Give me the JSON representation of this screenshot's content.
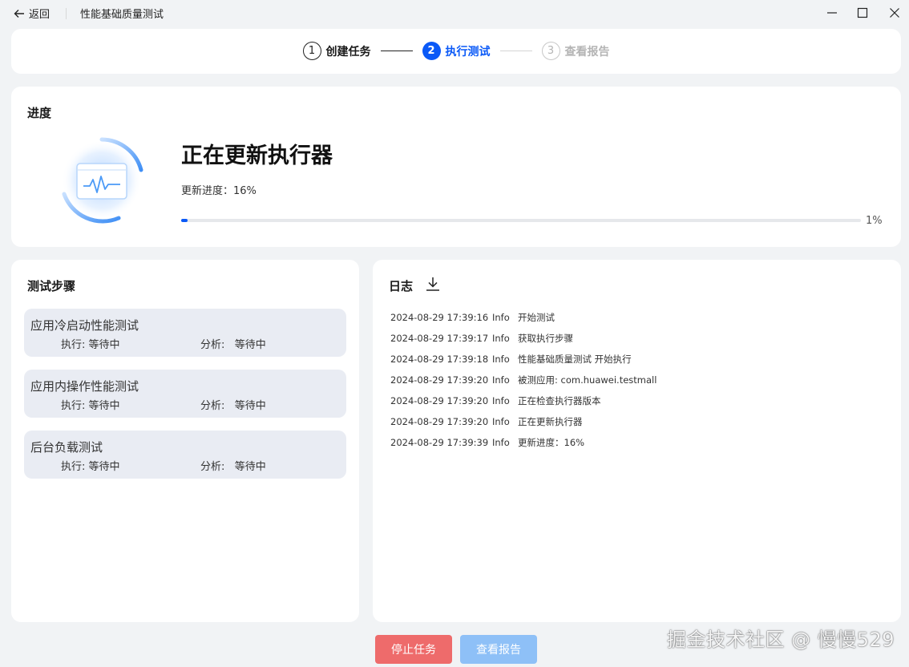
{
  "titlebar": {
    "back_label": "返回",
    "title": "性能基础质量测试"
  },
  "stepper": {
    "steps": [
      {
        "num": "1",
        "label": "创建任务",
        "state": "done"
      },
      {
        "num": "2",
        "label": "执行测试",
        "state": "active"
      },
      {
        "num": "3",
        "label": "查看报告",
        "state": "pending"
      }
    ]
  },
  "progress": {
    "section_title": "进度",
    "status_title": "正在更新执行器",
    "sub_text": "更新进度：16%",
    "bar_value": 0.01,
    "bar_percent_text": "1%"
  },
  "test_steps": {
    "section_title": "测试步骤",
    "items": [
      {
        "name": "应用冷启动性能测试",
        "exec_label": "执行:",
        "exec_value": "等待中",
        "analysis_label": "分析:",
        "analysis_value": "等待中"
      },
      {
        "name": "应用内操作性能测试",
        "exec_label": "执行:",
        "exec_value": "等待中",
        "analysis_label": "分析:",
        "analysis_value": "等待中"
      },
      {
        "name": "后台负载测试",
        "exec_label": "执行:",
        "exec_value": "等待中",
        "analysis_label": "分析:",
        "analysis_value": "等待中"
      }
    ]
  },
  "log": {
    "section_title": "日志",
    "entries": [
      {
        "time": "2024-08-29 17:39:16",
        "level": "Info",
        "message": "开始测试"
      },
      {
        "time": "2024-08-29 17:39:17",
        "level": "Info",
        "message": "获取执行步骤"
      },
      {
        "time": "2024-08-29 17:39:18",
        "level": "Info",
        "message": "性能基础质量测试 开始执行"
      },
      {
        "time": "2024-08-29 17:39:20",
        "level": "Info",
        "message": "被测应用: com.huawei.testmall"
      },
      {
        "time": "2024-08-29 17:39:20",
        "level": "Info",
        "message": "正在检查执行器版本"
      },
      {
        "time": "2024-08-29 17:39:20",
        "level": "Info",
        "message": "正在更新执行器"
      },
      {
        "time": "2024-08-29 17:39:39",
        "level": "Info",
        "message": "更新进度：16%"
      }
    ]
  },
  "buttons": {
    "stop": "停止任务",
    "report": "查看报告"
  },
  "watermark": "掘金技术社区 @ 慢慢529",
  "colors": {
    "accent": "#0a59f7",
    "stop_button": "#ee6b6b",
    "report_button_disabled": "#8ec0f7",
    "test_item_bg": "#e9ecf3"
  }
}
